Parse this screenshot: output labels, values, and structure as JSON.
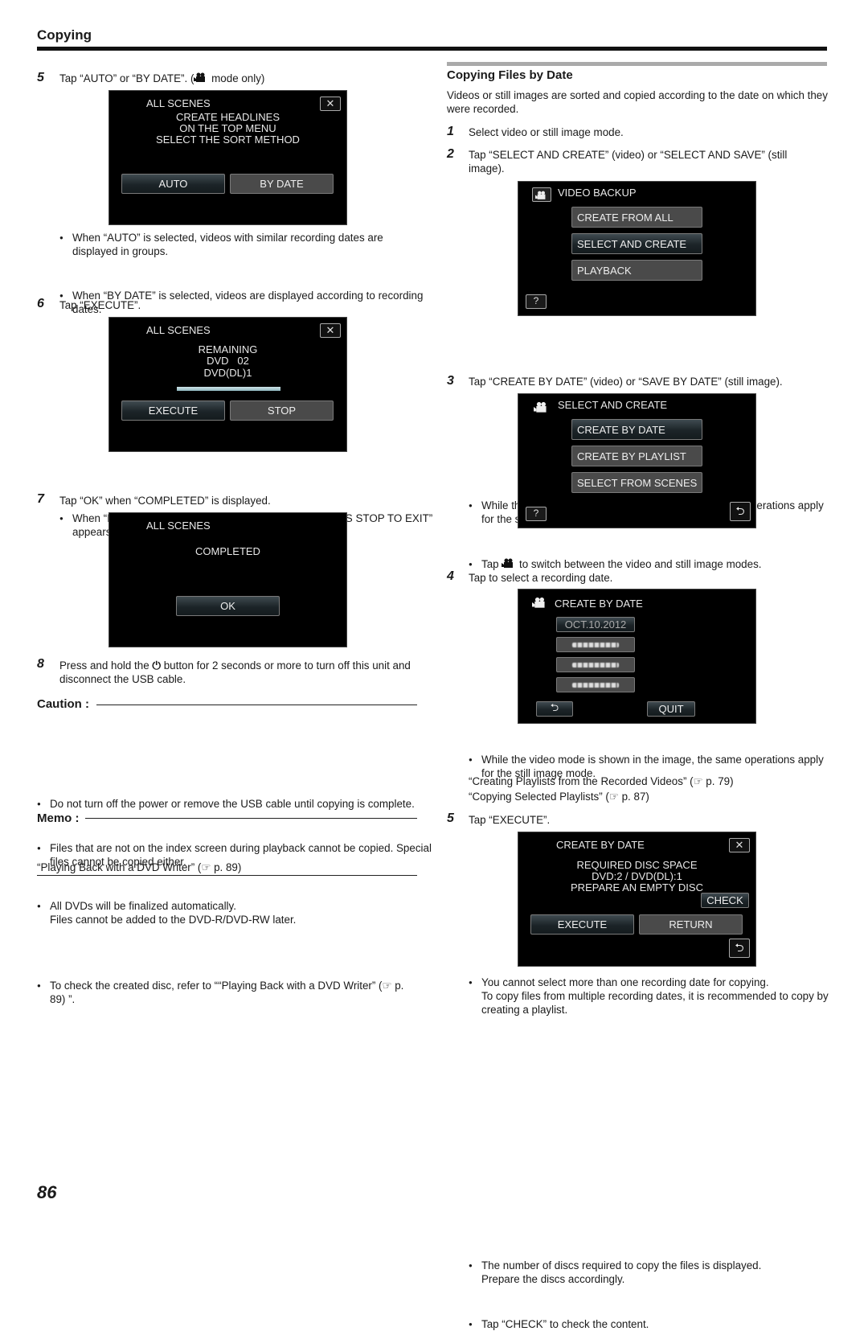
{
  "header": {
    "title": "Copying"
  },
  "left": {
    "step5": {
      "num": "5",
      "text_a": "Tap “AUTO” or “BY DATE”. (",
      "text_b": " mode only)"
    },
    "screen1": {
      "title": "ALL SCENES",
      "lines": [
        "CREATE HEADLINES",
        "ON THE TOP MENU",
        "SELECT THE SORT METHOD"
      ],
      "btn_auto": "AUTO",
      "btn_by_date": "BY DATE"
    },
    "bullets5": [
      "When “AUTO” is selected, videos with similar recording dates are displayed in groups.",
      "When “BY DATE” is selected, videos are displayed according to recording dates."
    ],
    "step6": {
      "num": "6",
      "text": "Tap “EXECUTE”."
    },
    "screen2": {
      "title": "ALL SCENES",
      "lines": [
        "REMAINING",
        "DVD   02",
        "DVD(DL)1"
      ],
      "progress": 1.0,
      "btn_execute": "EXECUTE",
      "btn_stop": "STOP"
    },
    "bullets6": [
      "When “INSERT THE NEXT DISC TO CREATE OR PRESS STOP TO EXIT” appears, change the disc."
    ],
    "step7": {
      "num": "7",
      "text": "Tap “OK” when “COMPLETED” is displayed."
    },
    "screen3": {
      "title": "ALL SCENES",
      "status": "COMPLETED",
      "btn_ok": "OK"
    },
    "step8": {
      "num": "8",
      "text_a": "Press and hold the ",
      "text_b": " button for 2 seconds or more to turn off this unit and disconnect the USB cable."
    },
    "caution": {
      "title": "Caution :",
      "items": [
        "Do not turn off the power or remove the USB cable until copying is complete.",
        "Files that are not on the index screen during playback cannot be copied. Special files cannot be copied either.",
        "All DVDs will be finalized automatically.\nFiles cannot be added to the DVD-R/DVD-RW later."
      ]
    },
    "memo": {
      "title": "Memo :",
      "item": "To check the created disc, refer to ““Playing Back with a DVD Writer” (☞ p. 89) ”.",
      "link": "“Playing Back with a DVD Writer” (☞ p. 89)"
    }
  },
  "right": {
    "section_title": "Copying Files by Date",
    "intro": "Videos or still images are sorted and copied according to the date on which they were recorded.",
    "step1": {
      "num": "1",
      "text": "Select video or still image mode."
    },
    "step2": {
      "num": "2",
      "text": "Tap “SELECT AND CREATE” (video) or “SELECT AND SAVE” (still image)."
    },
    "screen4": {
      "title": "VIDEO BACKUP",
      "items": [
        "CREATE FROM ALL",
        "SELECT AND CREATE",
        "PLAYBACK"
      ],
      "help": "?"
    },
    "bullets2": {
      "b1": "While the video mode is shown in the image, the same operations apply for the still image mode.",
      "b2a": "Tap ",
      "b2b": " to switch between the video and still image modes."
    },
    "step3": {
      "num": "3",
      "text": "Tap “CREATE BY DATE” (video) or “SAVE BY DATE” (still image)."
    },
    "screen5": {
      "title": "SELECT AND CREATE",
      "items": [
        "CREATE BY DATE",
        "CREATE BY PLAYLIST",
        "SELECT FROM SCENES"
      ],
      "help": "?",
      "back": "⮌"
    },
    "bullets3": [
      "While the video mode is shown in the image, the same operations apply for the still image mode."
    ],
    "step4": {
      "num": "4",
      "text": "Tap to select a recording date."
    },
    "screen6": {
      "title": "CREATE BY DATE",
      "dates": [
        "OCT.10.2012"
      ],
      "quit": "QUIT",
      "back": "⮌"
    },
    "bullets4": {
      "b1": "You cannot select more than one recording date for copying.\nTo copy files from multiple recording dates, it is recommended to copy by creating a playlist.",
      "link1": "“Creating Playlists from the Recorded Videos” (☞ p. 79)",
      "link2": "“Copying Selected Playlists” (☞ p. 87)"
    },
    "step5": {
      "num": "5",
      "text": "Tap “EXECUTE”."
    },
    "screen7": {
      "title": "CREATE BY DATE",
      "lines": [
        "REQUIRED DISC SPACE",
        "DVD:2 / DVD(DL):1",
        "PREPARE AN EMPTY DISC"
      ],
      "check": "CHECK",
      "execute": "EXECUTE",
      "return": "RETURN",
      "back": "⮌"
    },
    "bullets5": [
      "The number of discs required to copy the files is displayed.\nPrepare the discs accordingly.",
      "Tap “CHECK” to check the content."
    ]
  },
  "footer": {
    "page_number": "86"
  },
  "icons": {
    "close": "✕",
    "power": "⏻"
  }
}
